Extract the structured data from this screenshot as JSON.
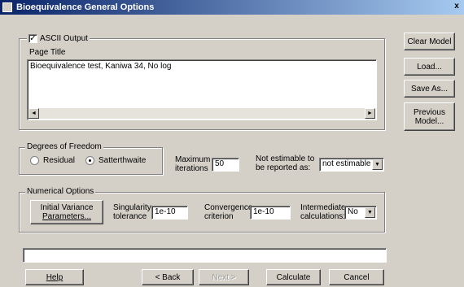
{
  "window": {
    "title": "Bioequivalence General Options",
    "close_glyph": "x"
  },
  "page_title_group": {
    "ascii_output_label": "ASCII Output",
    "ascii_output_checked": true,
    "page_title_label": "Page Title",
    "page_title_value": "Bioequivalence test, Kaniwa 34, No log"
  },
  "side_buttons": {
    "clear_model": "Clear Model",
    "load": "Load...",
    "save_as": "Save As...",
    "previous_model_line1": "Previous",
    "previous_model_line2": "Model..."
  },
  "degrees_of_freedom": {
    "legend": "Degrees of Freedom",
    "residual_label": "Residual",
    "satterthwaite_label": "Satterthwaite",
    "selected": "Satterthwaite"
  },
  "iterations": {
    "label_line1": "Maximum",
    "label_line2": "iterations",
    "value": "50"
  },
  "not_estimable": {
    "label_line1": "Not estimable to",
    "label_line2": "be reported as:",
    "value": "not estimable"
  },
  "numerical_options": {
    "legend": "Numerical Options",
    "initial_variance_line1": "Initial Variance",
    "initial_variance_line2": "Parameters...",
    "singularity_line1": "Singularity",
    "singularity_line2": "tolerance",
    "singularity_value": "1e-10",
    "convergence_line1": "Convergence",
    "convergence_line2": "criterion",
    "convergence_value": "1e-10",
    "intermediate_line1": "Intermediate",
    "intermediate_line2": "calculations:",
    "intermediate_value": "No"
  },
  "status_field": {
    "value": ""
  },
  "bottom_buttons": {
    "help": "Help",
    "back": "< Back",
    "next": "Next >",
    "calculate": "Calculate",
    "cancel": "Cancel"
  }
}
